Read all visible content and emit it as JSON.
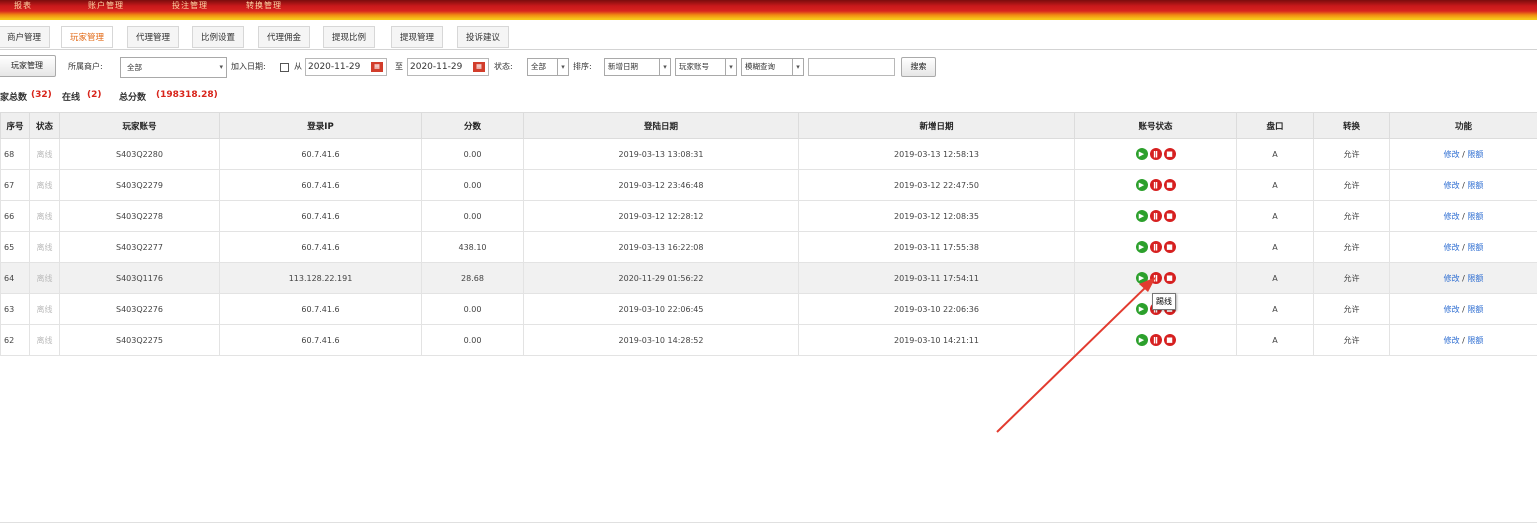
{
  "topbar": {
    "items": [
      "报表",
      "账户管理",
      "投注管理",
      "转换管理"
    ]
  },
  "tabs": [
    "商户管理",
    "玩家管理",
    "代理管理",
    "比例设置",
    "代理佣金",
    "提现比例",
    "提现管理",
    "投诉建议"
  ],
  "active_tab": "玩家管理",
  "filter": {
    "section_label": "玩家管理",
    "merchant_label": "所属商户:",
    "merchant_value": "全部",
    "join_date_label": "加入日期:",
    "from_label": "从",
    "from_date": "2020-11-29",
    "to_label": "至",
    "to_date": "2020-11-29",
    "status_label": "状态:",
    "status_value": "全部",
    "sort_label": "排序:",
    "sort_value": "新增日期",
    "field_value": "玩家账号",
    "match_value": "模糊查询",
    "search_placeholder": "",
    "search_button": "搜索"
  },
  "stats": {
    "total_label": "家总数",
    "total_value": "(32)",
    "online_label": "在线",
    "online_value": "(2)",
    "score_label": "总分数",
    "score_value": "(198318.28)"
  },
  "table": {
    "headers": [
      "序号",
      "状态",
      "玩家账号",
      "登录IP",
      "分数",
      "登陆日期",
      "新增日期",
      "账号状态",
      "盘口",
      "转换",
      "功能"
    ],
    "rows": [
      {
        "id": "68",
        "status": "离线",
        "account": "S403Q2280",
        "ip": "60.7.41.6",
        "score": "0.00",
        "login": "2019-03-13 13:08:31",
        "added": "2019-03-13 12:58:13",
        "pan": "A",
        "convert": "允许"
      },
      {
        "id": "67",
        "status": "离线",
        "account": "S403Q2279",
        "ip": "60.7.41.6",
        "score": "0.00",
        "login": "2019-03-12 23:46:48",
        "added": "2019-03-12 22:47:50",
        "pan": "A",
        "convert": "允许"
      },
      {
        "id": "66",
        "status": "离线",
        "account": "S403Q2278",
        "ip": "60.7.41.6",
        "score": "0.00",
        "login": "2019-03-12 12:28:12",
        "added": "2019-03-12 12:08:35",
        "pan": "A",
        "convert": "允许"
      },
      {
        "id": "65",
        "status": "离线",
        "account": "S403Q2277",
        "ip": "60.7.41.6",
        "score": "438.10",
        "login": "2019-03-13 16:22:08",
        "added": "2019-03-11 17:55:38",
        "pan": "A",
        "convert": "允许"
      },
      {
        "id": "64",
        "status": "离线",
        "account": "S403Q1176",
        "ip": "113.128.22.191",
        "score": "28.68",
        "login": "2020-11-29 01:56:22",
        "added": "2019-03-11 17:54:11",
        "pan": "A",
        "convert": "允许"
      },
      {
        "id": "63",
        "status": "离线",
        "account": "S403Q2276",
        "ip": "60.7.41.6",
        "score": "0.00",
        "login": "2019-03-10 22:06:45",
        "added": "2019-03-10 22:06:36",
        "pan": "A",
        "convert": "允许"
      },
      {
        "id": "62",
        "status": "离线",
        "account": "S403Q2275",
        "ip": "60.7.41.6",
        "score": "0.00",
        "login": "2019-03-10 14:28:52",
        "added": "2019-03-10 14:21:11",
        "pan": "A",
        "convert": "允许"
      }
    ],
    "edit_label": "修改",
    "limit_label": "限额",
    "icons": [
      "play-icon",
      "pause-icon",
      "stop-icon"
    ]
  },
  "tooltip": "踢线",
  "highlight_row": "64",
  "colors": {
    "accent_orange": "#e36c1a",
    "stat_red": "#d8251b",
    "link_blue": "#2a6bd1",
    "icon_green": "#2ca02c",
    "icon_red": "#d62020",
    "arrow_red": "#e23b2f"
  }
}
